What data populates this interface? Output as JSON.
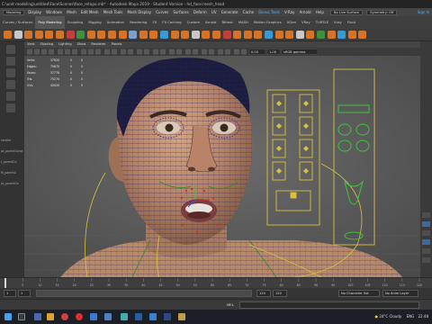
{
  "window": {
    "title": "C:\\unit modeling\\untitled\\Face\\Scenes\\face_retopo.mb* - Autodesk Maya 2019 - Student Version - hd_face:mesh_head"
  },
  "menubar": {
    "items": [
      "Display",
      "Windows",
      "Mesh",
      "Edit Mesh",
      "Mesh Tools",
      "Mesh Display",
      "Curves",
      "Surfaces",
      "Deform",
      "UV",
      "Generate",
      "Cache",
      "Bonus Tools",
      "V-Ray",
      "Arnold",
      "Help"
    ],
    "mode_label": "Modeling",
    "no_live": "No Live Surface",
    "symmetry": "Symmetry: Off",
    "sign_in": "Sign In"
  },
  "shelf_tabs": [
    "Curves / Surfaces",
    "Poly Modeling",
    "Sculpting",
    "Rigging",
    "Animation",
    "Rendering",
    "FX",
    "FX Caching",
    "Custom",
    "Arnold",
    "Bifrost",
    "MASH",
    "Motion Graphics",
    "XGen",
    "VRay",
    "TURTLE",
    "Vray",
    "Fluid"
  ],
  "shelf_active_index": 1,
  "panel_menu": [
    "View",
    "Shading",
    "Lighting",
    "Show",
    "Renderer",
    "Panels"
  ],
  "panel_toolbar": {
    "field1": "0.00",
    "field2": "1.00",
    "colorspace": "sRGB gamma"
  },
  "hud": {
    "rows": [
      {
        "label": "Verts:",
        "a": "37920",
        "b": "0",
        "c": "0"
      },
      {
        "label": "Edges:",
        "a": "75670",
        "b": "0",
        "c": "0"
      },
      {
        "label": "Faces:",
        "a": "37776",
        "b": "0",
        "c": "0"
      },
      {
        "label": "Tris:",
        "a": "75270",
        "b": "0",
        "c": "0"
      },
      {
        "label": "UVs:",
        "a": "40020",
        "b": "0",
        "c": "0"
      }
    ]
  },
  "left_panel": {
    "labels": [
      "ntroller",
      "pt_parentConst",
      "t_parentCo",
      "M_parentC",
      "pt_parentCo"
    ]
  },
  "timeslider": {
    "ticks": [
      "1",
      "5",
      "10",
      "15",
      "20",
      "25",
      "30",
      "35",
      "40",
      "45",
      "50",
      "55",
      "60",
      "65",
      "70",
      "75",
      "80",
      "85",
      "90",
      "95",
      "100",
      "105",
      "110",
      "115",
      "120"
    ]
  },
  "range": {
    "start": "1",
    "end": "120",
    "end2": "120",
    "current": "1",
    "char_set": "No Character Set",
    "anim_layer": "No Anim Layer",
    "fps": "24 fps"
  },
  "mel": {
    "label": "MEL"
  },
  "taskbar": {
    "weather": "24°C",
    "weather_text": "Cloudy",
    "lang": "ENG",
    "time": "22:48"
  },
  "colors": {
    "accent": "#5ab0f0",
    "skin": "#b98a6a",
    "wire": "#2b2a6e"
  }
}
